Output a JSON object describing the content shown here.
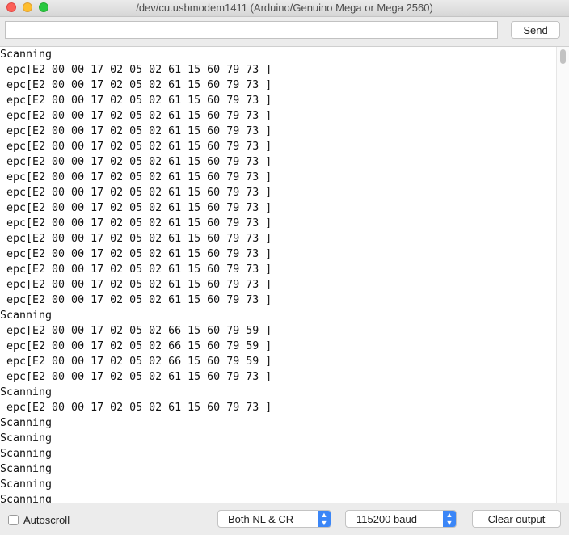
{
  "window": {
    "title": "/dev/cu.usbmodem1411 (Arduino/Genuino Mega or Mega 2560)"
  },
  "toolbar": {
    "input_value": "",
    "send_label": "Send"
  },
  "output": {
    "lines": [
      "Scanning",
      " epc[E2 00 00 17 02 05 02 61 15 60 79 73 ]",
      " epc[E2 00 00 17 02 05 02 61 15 60 79 73 ]",
      " epc[E2 00 00 17 02 05 02 61 15 60 79 73 ]",
      " epc[E2 00 00 17 02 05 02 61 15 60 79 73 ]",
      " epc[E2 00 00 17 02 05 02 61 15 60 79 73 ]",
      " epc[E2 00 00 17 02 05 02 61 15 60 79 73 ]",
      " epc[E2 00 00 17 02 05 02 61 15 60 79 73 ]",
      " epc[E2 00 00 17 02 05 02 61 15 60 79 73 ]",
      " epc[E2 00 00 17 02 05 02 61 15 60 79 73 ]",
      " epc[E2 00 00 17 02 05 02 61 15 60 79 73 ]",
      " epc[E2 00 00 17 02 05 02 61 15 60 79 73 ]",
      " epc[E2 00 00 17 02 05 02 61 15 60 79 73 ]",
      " epc[E2 00 00 17 02 05 02 61 15 60 79 73 ]",
      " epc[E2 00 00 17 02 05 02 61 15 60 79 73 ]",
      " epc[E2 00 00 17 02 05 02 61 15 60 79 73 ]",
      " epc[E2 00 00 17 02 05 02 61 15 60 79 73 ]",
      "Scanning",
      " epc[E2 00 00 17 02 05 02 66 15 60 79 59 ]",
      " epc[E2 00 00 17 02 05 02 66 15 60 79 59 ]",
      " epc[E2 00 00 17 02 05 02 66 15 60 79 59 ]",
      " epc[E2 00 00 17 02 05 02 61 15 60 79 73 ]",
      "Scanning",
      " epc[E2 00 00 17 02 05 02 61 15 60 79 73 ]",
      "Scanning",
      "Scanning",
      "Scanning",
      "Scanning",
      "Scanning",
      "Scanning"
    ]
  },
  "footer": {
    "autoscroll_label": "Autoscroll",
    "autoscroll_checked": false,
    "line_ending_value": "Both NL & CR",
    "baud_value": "115200 baud",
    "clear_label": "Clear output"
  }
}
